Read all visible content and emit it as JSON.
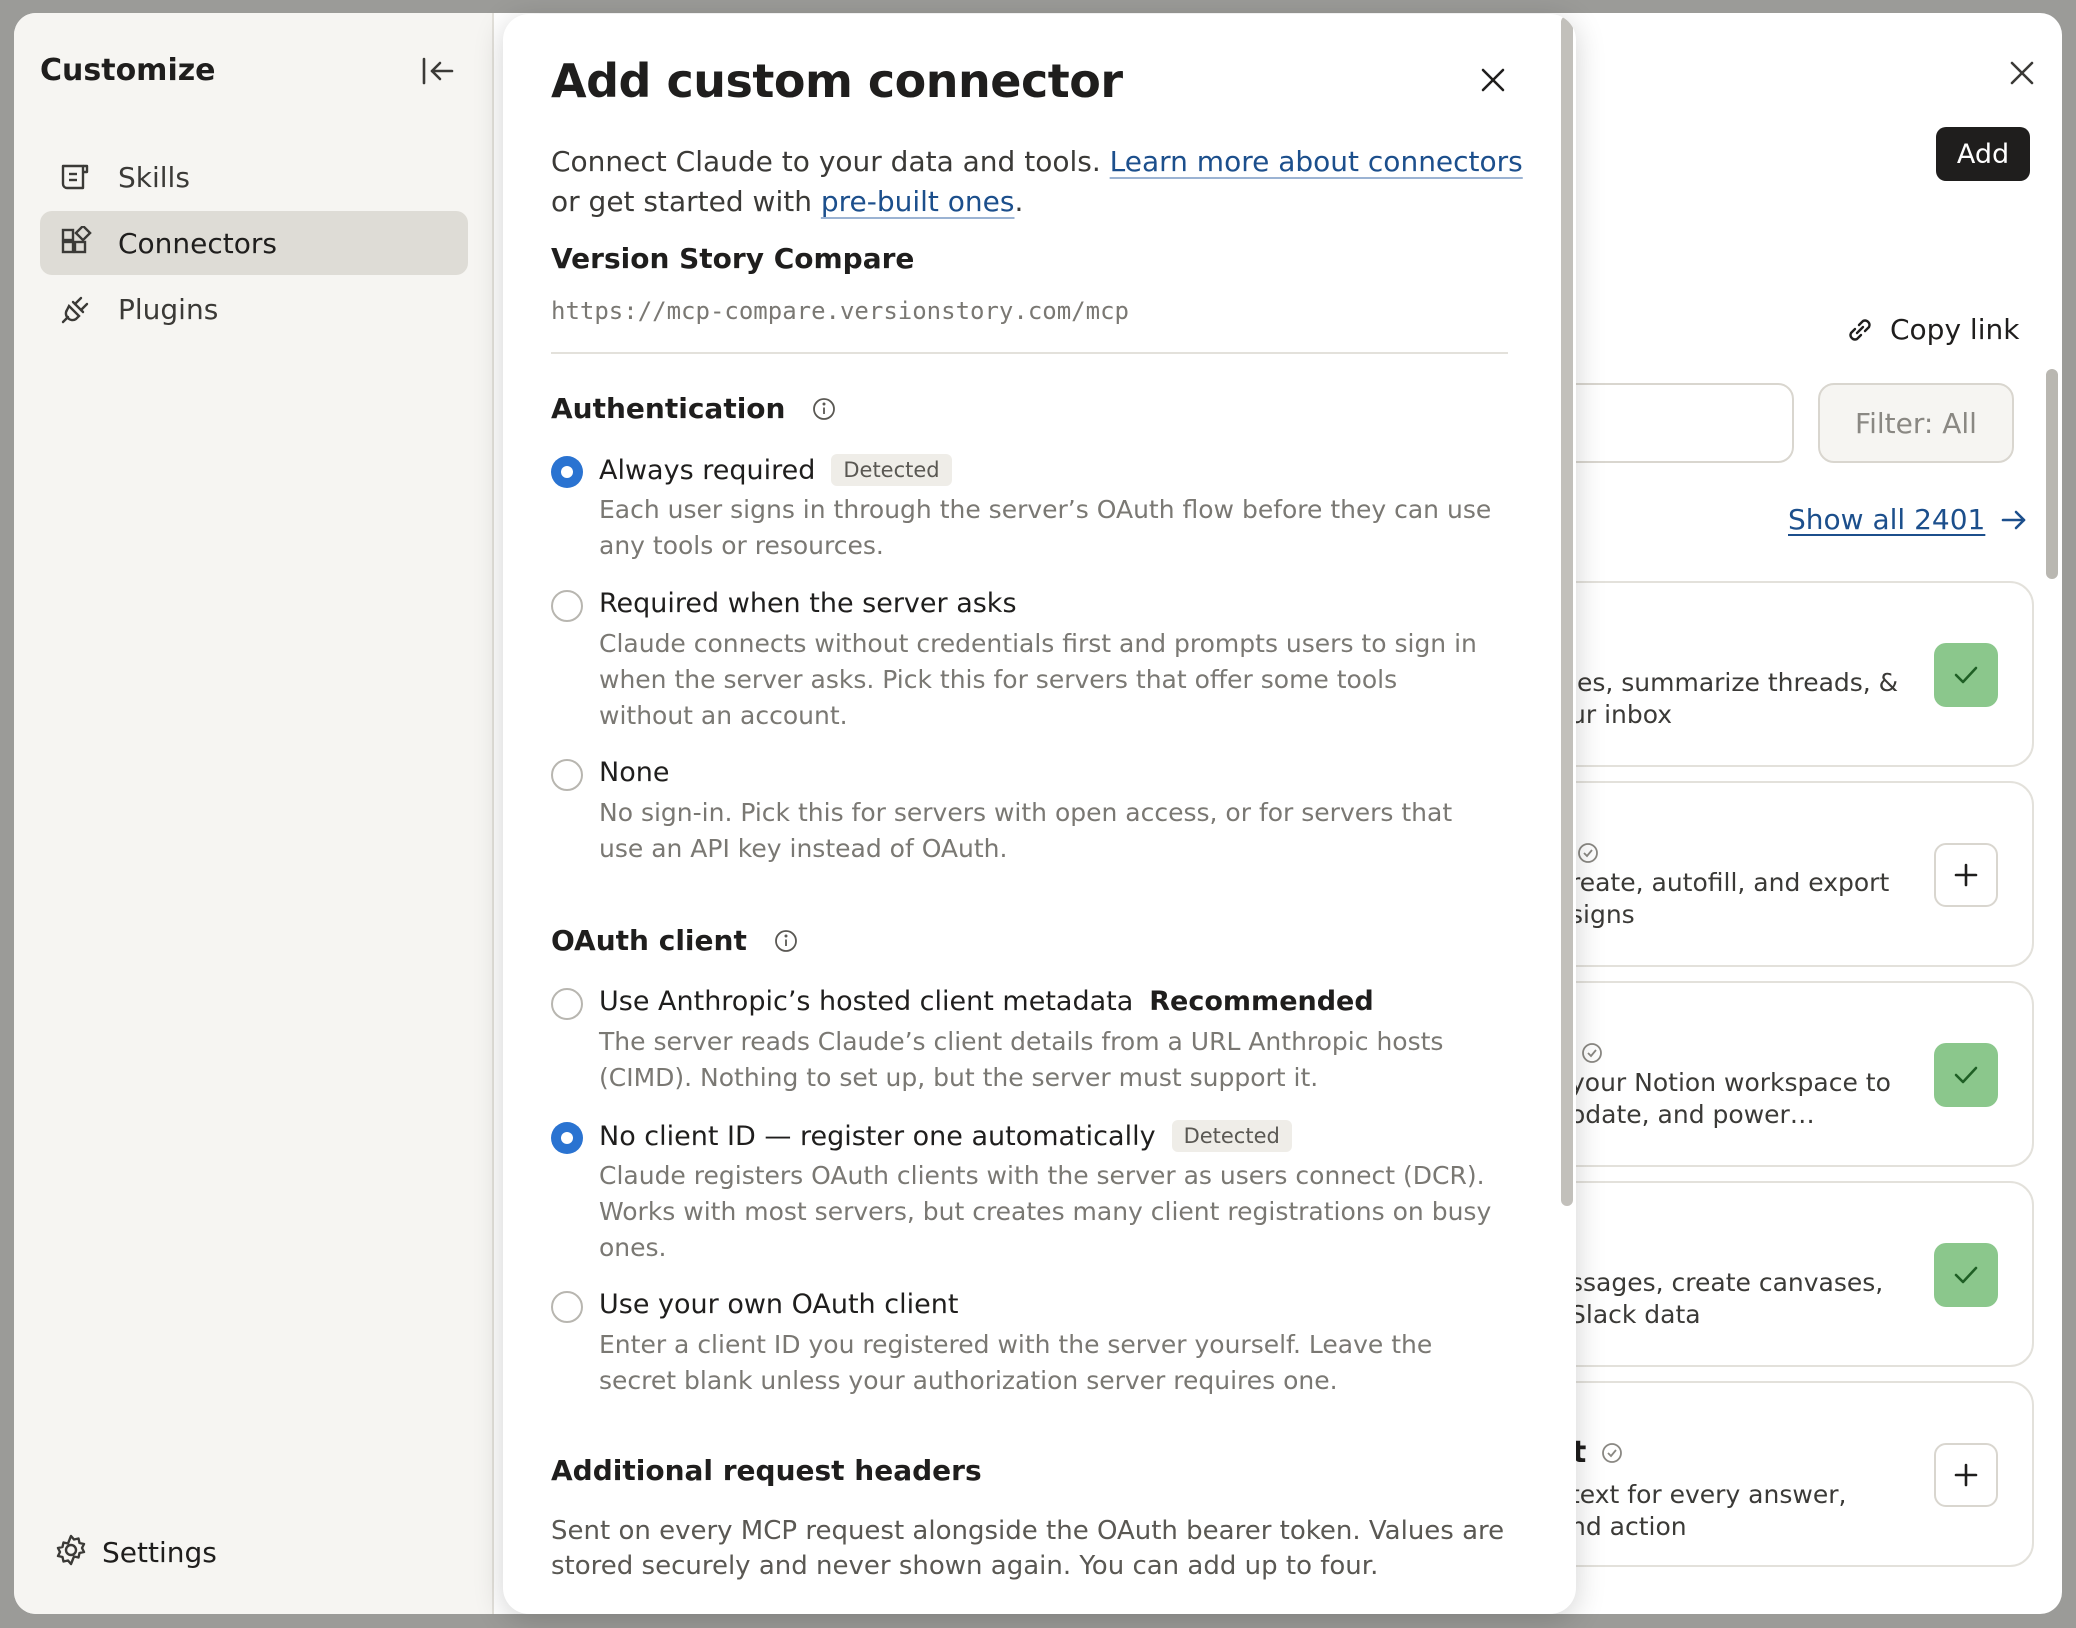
{
  "sidebar": {
    "title": "Customize",
    "items": [
      {
        "label": "Skills",
        "icon": "skills-icon",
        "active": false
      },
      {
        "label": "Connectors",
        "icon": "connectors-icon",
        "active": true
      },
      {
        "label": "Plugins",
        "icon": "plugins-icon",
        "active": false
      }
    ],
    "settings_label": "Settings"
  },
  "main": {
    "add_label": "Add",
    "copy_link_label": "Copy link",
    "filter_label": "Filter: All",
    "show_all_label": "Show all 2401",
    "cards": [
      {
        "desc": "ies, summarize threads, &\nur inbox",
        "status": "connected"
      },
      {
        "desc": "reate, autofill, and export\nsigns",
        "status": "add"
      },
      {
        "desc": "your Notion workspace to\nodate, and power…",
        "status": "connected"
      },
      {
        "desc": "ssages, create canvases,\n Slack data",
        "status": "connected"
      },
      {
        "title_fragment": "t",
        "desc": "text for every answer,\nnd action",
        "status": "add"
      }
    ]
  },
  "modal": {
    "title": "Add custom connector",
    "intro_prefix": "Connect Claude to your data and tools. ",
    "intro_link1": "Learn more about connectors",
    "intro_middle": " or get started with ",
    "intro_link2": "pre-built ones",
    "intro_suffix": ".",
    "server_name": "Version Story Compare",
    "server_url": "https://mcp-compare.versionstory.com/mcp",
    "authentication": {
      "heading": "Authentication",
      "options": [
        {
          "label": "Always required",
          "badge": "Detected",
          "checked": true,
          "desc": "Each user signs in through the server’s OAuth flow before they can use any tools or resources."
        },
        {
          "label": "Required when the server asks",
          "checked": false,
          "desc": "Claude connects without credentials first and prompts users to sign in when the server asks. Pick this for servers that offer some tools without an account."
        },
        {
          "label": "None",
          "checked": false,
          "desc": "No sign-in. Pick this for servers with open access, or for servers that use an API key instead of OAuth."
        }
      ]
    },
    "oauth_client": {
      "heading": "OAuth client",
      "options": [
        {
          "label": "Use Anthropic’s hosted client metadata",
          "tag": "Recommended",
          "checked": false,
          "desc": "The server reads Claude’s client details from a URL Anthropic hosts (CIMD). Nothing to set up, but the server must support it."
        },
        {
          "label": "No client ID — register one automatically",
          "badge": "Detected",
          "checked": true,
          "desc": "Claude registers OAuth clients with the server as users connect (DCR). Works with most servers, but creates many client registrations on busy ones."
        },
        {
          "label": "Use your own OAuth client",
          "checked": false,
          "desc": "Enter a client ID you registered with the server yourself. Leave the secret blank unless your authorization server requires one."
        }
      ]
    },
    "headers": {
      "heading": "Additional request headers",
      "desc": "Sent on every MCP request alongside the OAuth bearer token. Values are stored securely and never shown again. You can add up to four."
    }
  },
  "colors": {
    "accent_blue": "#2a73d1",
    "link": "#1c4f8c",
    "connected_green": "#8bc78c"
  }
}
